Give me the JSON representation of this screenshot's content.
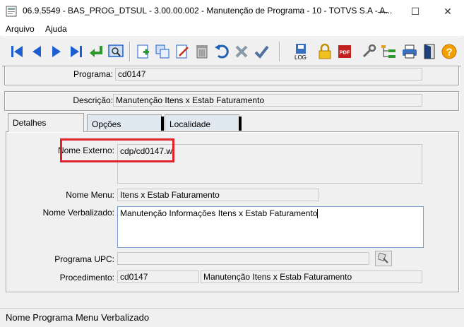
{
  "window": {
    "title": "06.9.5549 - BAS_PROG_DTSUL - 3.00.00.002 - Manutenção de Programa - 10 - TOTVS S.A - A...",
    "minimize": "—",
    "maximize": "☐",
    "close": "✕"
  },
  "menu": {
    "file": "Arquivo",
    "help": "Ajuda"
  },
  "toolbar": {
    "log_label": "LOG",
    "pdf_label": "PDF",
    "help_glyph": "?"
  },
  "form": {
    "programa_label": "Programa:",
    "programa_value": "cd0147",
    "descricao_label": "Descrição:",
    "descricao_value": "Manutenção Itens x Estab Faturamento"
  },
  "tabs": [
    {
      "label": "Detalhes",
      "active": true
    },
    {
      "label": "Opções",
      "active": false
    },
    {
      "label": "Localidade",
      "active": false
    }
  ],
  "details": {
    "nome_externo_label": "Nome Externo:",
    "nome_externo_value": "cdp/cd0147.w",
    "nome_menu_label": "Nome Menu:",
    "nome_menu_value": "Itens x Estab Faturamento",
    "nome_verbalizado_label": "Nome Verbalizado:",
    "nome_verbalizado_value": "Manutenção Informações Itens x Estab Faturamento",
    "programa_upc_label": "Programa UPC:",
    "programa_upc_value": "",
    "procedimento_label": "Procedimento:",
    "procedimento_code": "cd0147",
    "procedimento_desc": "Manutenção Itens x Estab Faturamento"
  },
  "status": {
    "text": "Nome Programa Menu Verbalizado"
  },
  "colors": {
    "highlight": "#e0202a",
    "nav_blue": "#1e5fcf",
    "tab_inactive": "#e0e8f0"
  }
}
